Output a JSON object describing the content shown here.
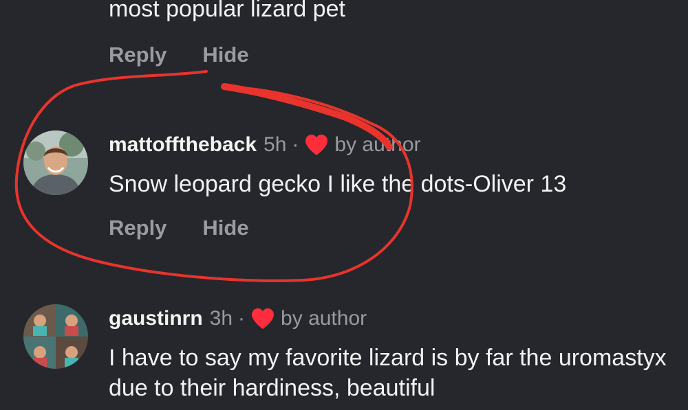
{
  "previous_comment": {
    "text_tail": "most popular lizard pet",
    "reply_label": "Reply",
    "hide_label": "Hide"
  },
  "comments": [
    {
      "username": "mattofftheback",
      "time": "5h",
      "separator": "·",
      "badge": "by author",
      "text": "Snow leopard gecko I like the dots-Oliver 13",
      "reply_label": "Reply",
      "hide_label": "Hide"
    },
    {
      "username": "gaustinrn",
      "time": "3h",
      "separator": "·",
      "badge": "by author",
      "text": "I have to say my favorite lizard is by far the uromastyx due to their hardiness, beautiful"
    }
  ],
  "icons": {
    "heart": "heart-icon"
  },
  "colors": {
    "background": "#26272c",
    "text": "#f2f2f2",
    "muted": "#9a9ba1",
    "heart": "#ff2d3b",
    "annotation": "#e8342c"
  }
}
